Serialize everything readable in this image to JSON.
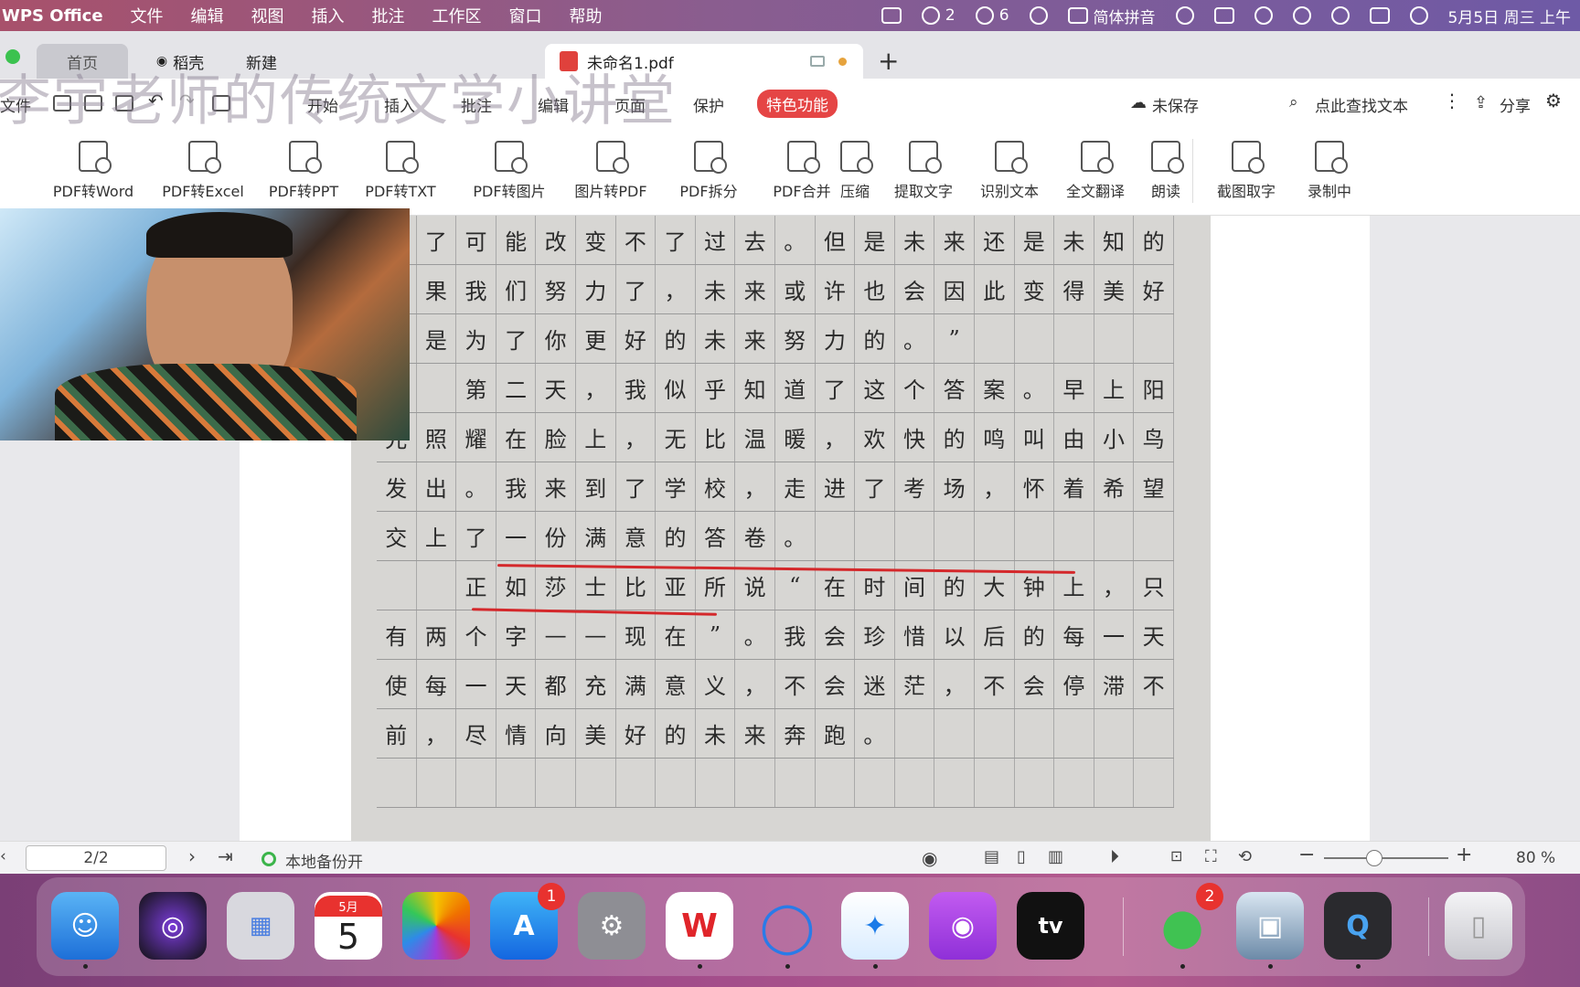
{
  "menubar": {
    "app_name": "WPS Office",
    "menus": [
      "文件",
      "编辑",
      "视图",
      "插入",
      "批注",
      "工作区",
      "窗口",
      "帮助"
    ],
    "wechat_count": "2",
    "chat_count": "6",
    "input_method": "简体拼音",
    "datetime": "5月5日 周三 上午"
  },
  "tabs": {
    "home": "首页",
    "daoke": "稻壳",
    "new": "新建",
    "document": "未命名1.pdf"
  },
  "watermark": "李宇老师的传统文学小讲堂",
  "menurow": {
    "file_partial": "文件",
    "items": [
      "开始",
      "插入",
      "批注",
      "编辑",
      "页面",
      "保护"
    ],
    "featured": "特色功能",
    "unsaved": "未保存",
    "search": "点此查找文本",
    "share": "分享"
  },
  "ribbon": {
    "buttons": [
      "PDF转Word",
      "PDF转Excel",
      "PDF转PPT",
      "PDF转TXT",
      "PDF转图片",
      "图片转PDF",
      "PDF拆分",
      "PDF合并",
      "压缩",
      "提取文字",
      "识别文本",
      "全文翻译",
      "朗读",
      "截图取字",
      "录制中"
    ]
  },
  "document_lines": [
    "力了可能改变不了过去。但是未来还是未知的",
    "如果我们努力了，未来或许也会因此变得美好",
    "都是为了你更好的未来努力的。”",
    "　　第二天，我似乎知道了这个答案。早上阳",
    "光照耀在脸上，无比温暖，欢快的鸣叫由小鸟",
    "发出。我来到了学校，走进了考场，怀着希望",
    "交上了一份满意的答卷。",
    "　　正如莎士比亚所说“在时间的大钟上，只",
    "有两个字——现在”。我会珍惜以后的每一天，",
    "使每一天都充满意义，不会迷茫，不会停滞不",
    "前，尽情向美好的未来奔跑。",
    ""
  ],
  "statusbar": {
    "page": "2/2",
    "backup": "本地备份开",
    "zoom": "80 %"
  },
  "dock": {
    "calendar_month": "5月",
    "calendar_day": "5",
    "appstore_badge": "1",
    "wechat_badge": "2",
    "appletv_label": "tv"
  }
}
